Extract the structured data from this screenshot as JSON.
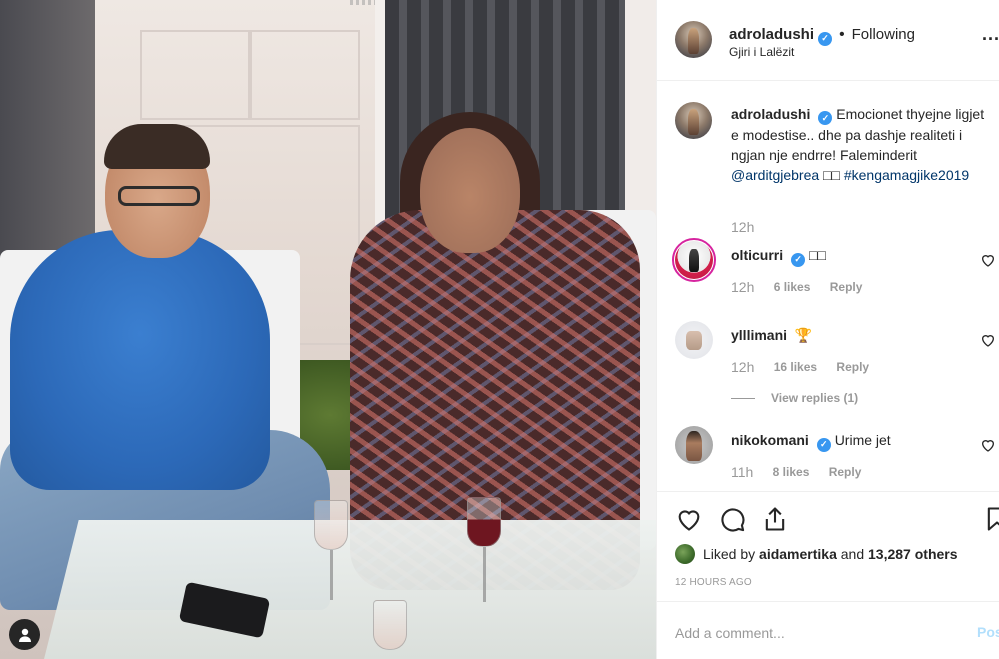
{
  "post": {
    "author": "adroladushi",
    "follow_state": "Following",
    "separator": "•",
    "location": "Gjiri i Lalëzit",
    "more_glyph": "...",
    "caption": {
      "username": "adroladushi",
      "text_before": "Emocionet thyejne ligjet e modestise.. dhe pa dashje realiteti i ngjan nje endrre! Faleminderit",
      "mention": "@arditgjebrea",
      "emoji": "□□",
      "hashtag": "#kengamagjike2019",
      "time": "12h"
    },
    "comments": [
      {
        "username": "olticurri",
        "verified": true,
        "text": "□□",
        "time": "12h",
        "likes": "6 likes",
        "reply": "Reply"
      },
      {
        "username": "ylllimani",
        "verified": false,
        "text": "🏆",
        "time": "12h",
        "likes": "16 likes",
        "reply": "Reply",
        "view_replies": "View replies (1)"
      },
      {
        "username": "nikokomani",
        "verified": true,
        "text": "Urime jet",
        "time": "11h",
        "likes": "8 likes",
        "reply": "Reply"
      }
    ],
    "likes": {
      "prefix": "Liked by",
      "first_liker": "aidamertika",
      "joiner": "and",
      "others": "13,287 others"
    },
    "posted_ago": "12 HOURS AGO",
    "add_comment_placeholder": "Add a comment...",
    "post_button": "Post",
    "verified_mark": "✓"
  },
  "colors": {
    "verified_blue": "#3897f0",
    "mention_link": "#003569",
    "muted_text": "#999999",
    "post_button_disabled": "#b2dffc"
  },
  "icons": [
    "user-badge-icon",
    "verified-icon",
    "more-options-icon",
    "heart-icon",
    "comment-icon",
    "share-icon",
    "bookmark-icon"
  ]
}
